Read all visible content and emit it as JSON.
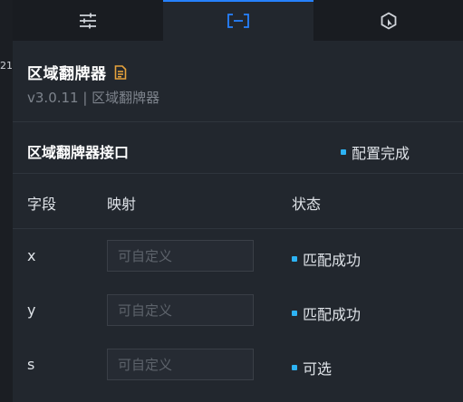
{
  "edge_text": "21",
  "tabs": [
    {
      "icon": "sliders-icon",
      "active": false
    },
    {
      "icon": "bracket-data-icon",
      "active": true
    },
    {
      "icon": "interaction-icon",
      "active": false
    }
  ],
  "header": {
    "title": "区域翻牌器",
    "version": "v3.0.11 | 区域翻牌器",
    "doc_icon": "document-icon"
  },
  "section": {
    "title": "区域翻牌器接口",
    "status": "配置完成"
  },
  "table": {
    "headers": {
      "field": "字段",
      "mapping": "映射",
      "status": "状态"
    },
    "rows": [
      {
        "field": "x",
        "placeholder": "可自定义",
        "value": "",
        "status": "匹配成功"
      },
      {
        "field": "y",
        "placeholder": "可自定义",
        "value": "",
        "status": "匹配成功"
      },
      {
        "field": "s",
        "placeholder": "可自定义",
        "value": "",
        "status": "可选"
      }
    ]
  },
  "colors": {
    "accent": "#2681ff",
    "status_dot": "#2db3f4",
    "doc_icon": "#e6a23c"
  }
}
